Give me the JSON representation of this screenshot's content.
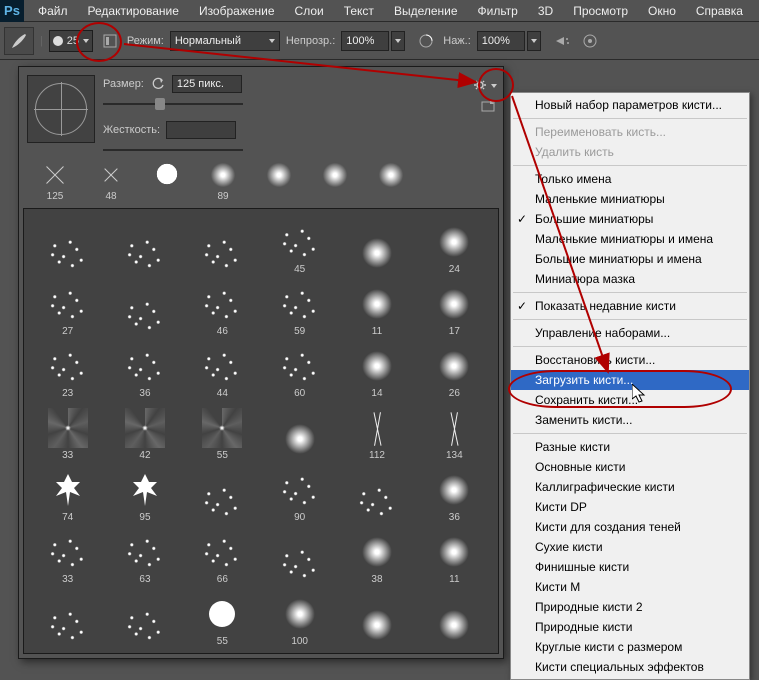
{
  "app": {
    "name": "Ps"
  },
  "menus": [
    "Файл",
    "Редактирование",
    "Изображение",
    "Слои",
    "Текст",
    "Выделение",
    "Фильтр",
    "3D",
    "Просмотр",
    "Окно",
    "Справка"
  ],
  "options": {
    "brush_size_display": "25",
    "mode_label": "Режим:",
    "mode_value": "Нормальный",
    "opacity_label": "Непрозр.:",
    "opacity_value": "100%",
    "flow_label": "Наж.:",
    "flow_value": "100%"
  },
  "brush_panel": {
    "size_label": "Размер:",
    "size_value": "125 пикс.",
    "hardness_label": "Жесткость:",
    "hardness_value": ""
  },
  "preset_row": [
    "125",
    "48",
    "",
    "89",
    "",
    "",
    ""
  ],
  "grid": [
    "",
    "",
    "",
    "45",
    "",
    "24",
    "27",
    "",
    "46",
    "59",
    "11",
    "17",
    "23",
    "36",
    "44",
    "60",
    "14",
    "26",
    "33",
    "42",
    "55",
    "",
    "112",
    "134",
    "74",
    "95",
    "",
    "90",
    "",
    "36",
    "33",
    "63",
    "66",
    "",
    "38",
    "11",
    "",
    "",
    "55",
    "100",
    "",
    ""
  ],
  "flyout": {
    "groups": [
      [
        {
          "t": "Новый набор параметров кисти..."
        }
      ],
      [
        {
          "t": "Переименовать кисть...",
          "disabled": true
        },
        {
          "t": "Удалить кисть",
          "disabled": true
        }
      ],
      [
        {
          "t": "Только имена"
        },
        {
          "t": "Маленькие миниатюры"
        },
        {
          "t": "Большие миниатюры",
          "checked": true
        },
        {
          "t": "Маленькие миниатюры и имена"
        },
        {
          "t": "Большие миниатюры и имена"
        },
        {
          "t": "Миниатюра мазка"
        }
      ],
      [
        {
          "t": "Показать недавние кисти",
          "checked": true
        }
      ],
      [
        {
          "t": "Управление наборами..."
        }
      ],
      [
        {
          "t": "Восстановить кисти..."
        },
        {
          "t": "Загрузить кисти...",
          "selected": true
        },
        {
          "t": "Сохранить кисти..."
        },
        {
          "t": "Заменить кисти..."
        }
      ],
      [
        {
          "t": "Разные кисти"
        },
        {
          "t": "Основные кисти"
        },
        {
          "t": "Каллиграфические кисти"
        },
        {
          "t": "Кисти DP"
        },
        {
          "t": "Кисти для создания теней"
        },
        {
          "t": "Сухие кисти"
        },
        {
          "t": "Финишные кисти"
        },
        {
          "t": "Кисти М"
        },
        {
          "t": "Природные кисти 2"
        },
        {
          "t": "Природные кисти"
        },
        {
          "t": "Круглые кисти с размером"
        },
        {
          "t": "Кисти специальных эффектов"
        }
      ]
    ]
  }
}
